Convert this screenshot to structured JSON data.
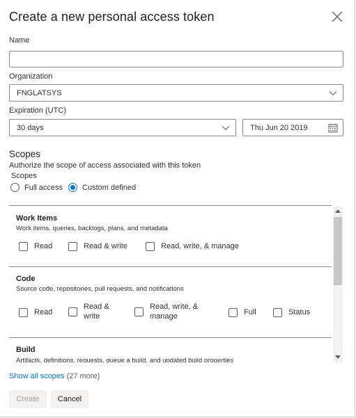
{
  "dialog": {
    "title": "Create a new personal access token",
    "close_icon": "close-icon"
  },
  "form": {
    "name_label": "Name",
    "name_value": "",
    "organization_label": "Organization",
    "organization_value": "FNGLATSYS",
    "expiration_label": "Expiration (UTC)",
    "expiration_value": "30 days",
    "expiration_date": "Thu Jun 20 2019"
  },
  "scopes": {
    "heading": "Scopes",
    "description": "Authorize the scope of access associated with this token",
    "sub_label": "Scopes",
    "options": [
      {
        "label": "Full access",
        "selected": false
      },
      {
        "label": "Custom defined",
        "selected": true
      }
    ],
    "sections": [
      {
        "title": "Work Items",
        "description": "Work items, queries, backlogs, plans, and metadata",
        "permissions": [
          "Read",
          "Read & write",
          "Read, write, & manage"
        ]
      },
      {
        "title": "Code",
        "description": "Source code, repositories, pull requests, and notifications",
        "permissions": [
          "Read",
          "Read & write",
          "Read, write, & manage",
          "Full",
          "Status"
        ]
      },
      {
        "title": "Build",
        "description": "Artifacts, definitions, requests, queue a build, and updated build properties",
        "permissions": []
      }
    ],
    "show_all_link": "Show all scopes",
    "show_all_count": "(27 more)"
  },
  "buttons": {
    "create": "Create",
    "cancel": "Cancel"
  },
  "colors": {
    "accent": "#0078d4",
    "border": "#8a8886",
    "disabled_text": "#a19f9d"
  }
}
